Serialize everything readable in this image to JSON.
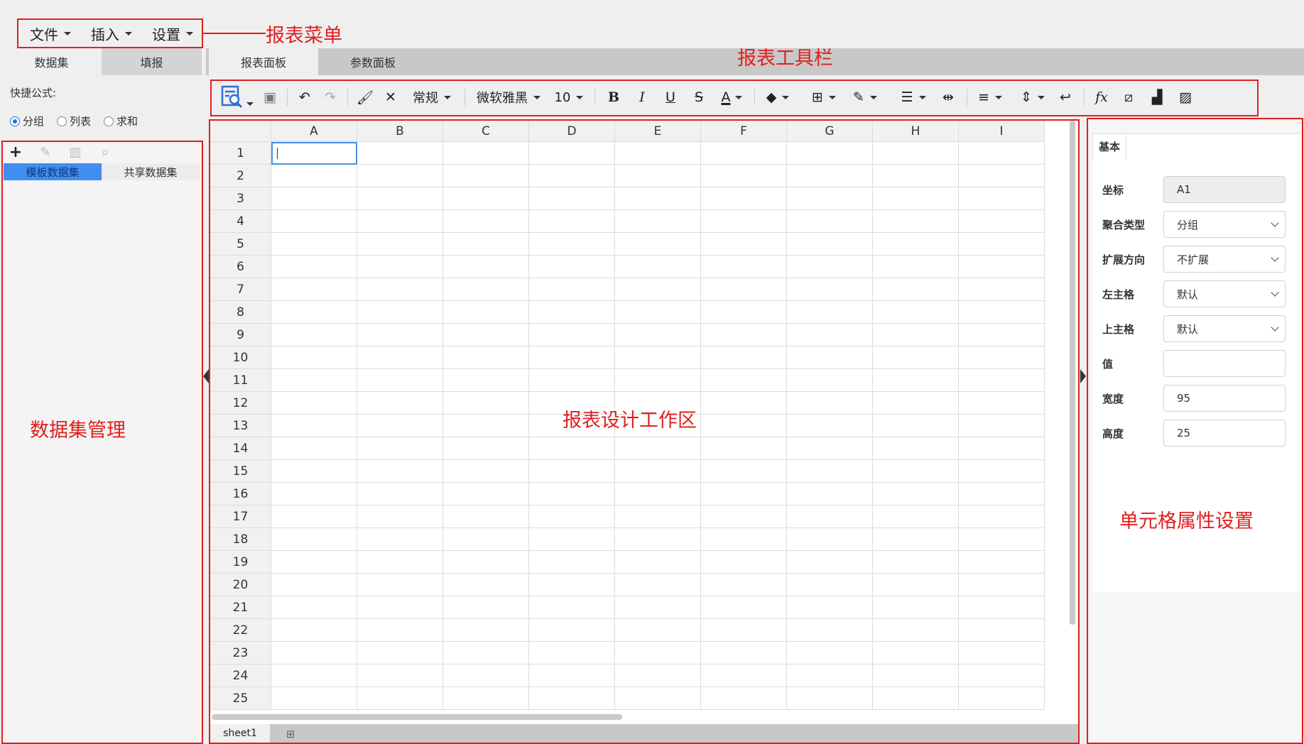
{
  "menu": {
    "items": [
      "文件",
      "插入",
      "设置"
    ]
  },
  "left_tabs": [
    "数据集",
    "填报"
  ],
  "quick_formula": {
    "label": "快捷公式:",
    "options": [
      {
        "label": "分组",
        "checked": true
      },
      {
        "label": "列表",
        "checked": false
      },
      {
        "label": "求和",
        "checked": false
      }
    ]
  },
  "dataset": {
    "tools": [
      "add-icon",
      "edit-icon",
      "delete-icon",
      "search-icon"
    ],
    "tabs": [
      "模板数据集",
      "共享数据集"
    ]
  },
  "main_tabs": [
    "报表面板",
    "参数面板"
  ],
  "toolbar": {
    "number_format": "常规",
    "font_family": "微软雅黑",
    "font_size": "10",
    "icons": [
      "preview-icon",
      "save-icon",
      "undo-icon",
      "redo-icon",
      "format-painter-icon",
      "clear-format-icon",
      "bold-icon",
      "italic-icon",
      "underline-icon",
      "strikethrough-icon",
      "font-color-icon",
      "fill-color-icon",
      "border-icon",
      "border-color-icon",
      "border-style-icon",
      "merge-cells-icon",
      "align-icon",
      "vertical-align-icon",
      "wrap-text-icon",
      "formula-icon",
      "slash-icon",
      "chart-icon",
      "image-icon"
    ]
  },
  "grid": {
    "columns": [
      "A",
      "B",
      "C",
      "D",
      "E",
      "F",
      "G",
      "H",
      "I"
    ],
    "rows": [
      "1",
      "2",
      "3",
      "4",
      "5",
      "6",
      "7",
      "8",
      "9",
      "10",
      "11",
      "12",
      "13",
      "14",
      "15",
      "16",
      "17",
      "18",
      "19",
      "20",
      "21",
      "22",
      "23",
      "24",
      "25"
    ],
    "selected_cell": "A1"
  },
  "sheets": [
    "sheet1"
  ],
  "properties": {
    "tab": "基本",
    "fields": [
      {
        "label": "坐标",
        "value": "A1",
        "kind": "readonly"
      },
      {
        "label": "聚合类型",
        "value": "分组",
        "kind": "select"
      },
      {
        "label": "扩展方向",
        "value": "不扩展",
        "kind": "select"
      },
      {
        "label": "左主格",
        "value": "默认",
        "kind": "select"
      },
      {
        "label": "上主格",
        "value": "默认",
        "kind": "select"
      },
      {
        "label": "值",
        "value": "",
        "kind": "input"
      },
      {
        "label": "宽度",
        "value": "95",
        "kind": "input"
      },
      {
        "label": "高度",
        "value": "25",
        "kind": "input"
      }
    ]
  },
  "annotations": {
    "report_menu": "报表菜单",
    "report_toolbar": "报表工具栏",
    "dataset_management": "数据集管理",
    "design_area": "报表设计工作区",
    "cell_properties": "单元格属性设置"
  },
  "colors": {
    "accent": "#e02020",
    "selection": "#4a8fe7",
    "tab_active": "#3f8ef0"
  }
}
